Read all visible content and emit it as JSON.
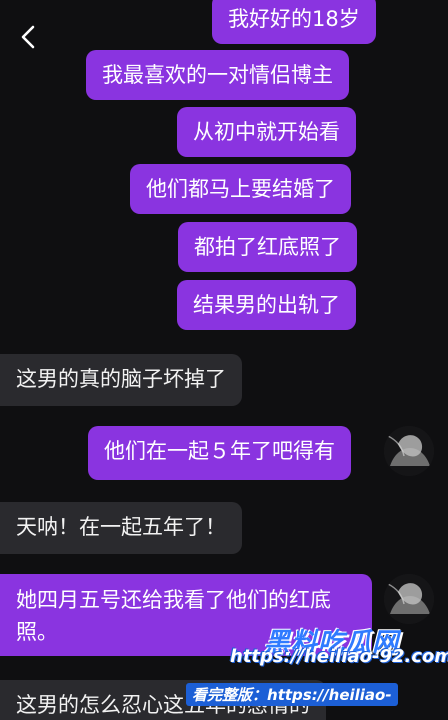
{
  "messages": [
    {
      "id": "m1",
      "side": "sent",
      "text": "我好好的18岁"
    },
    {
      "id": "m2",
      "side": "sent",
      "text": "我最喜欢的一对情侣博主"
    },
    {
      "id": "m3",
      "side": "sent",
      "text": "从初中就开始看"
    },
    {
      "id": "m4",
      "side": "sent",
      "text": "他们都马上要结婚了"
    },
    {
      "id": "m5",
      "side": "sent",
      "text": "都拍了红底照了"
    },
    {
      "id": "m6",
      "side": "sent",
      "text": "结果男的出轨了"
    },
    {
      "id": "m7",
      "side": "recv",
      "text": "这男的真的脑子坏掉了"
    },
    {
      "id": "m8",
      "side": "recv",
      "text": "他们在一起５年了吧得有"
    },
    {
      "id": "m9",
      "side": "recv",
      "text": "天呐！在一起五年了！"
    },
    {
      "id": "m10",
      "side": "recv",
      "text": "她四月五号还给我看了他们的红底照。"
    },
    {
      "id": "m11",
      "side": "recv",
      "text": "这男的怎么忍心这五年的感情的"
    }
  ],
  "watermark": {
    "logo": "黑料吃瓜网",
    "url": "https://heiliao-92.com",
    "tag_label": "看完整版：",
    "tag_url": "https://heiliao-"
  },
  "colors": {
    "background": "#0f0f11",
    "sent_bubble": "#8a34e0",
    "received_bubble": "#2a2a2e",
    "watermark_blue": "#1c5fd6"
  },
  "icons": {
    "back": "chevron-left-icon",
    "avatar": "contact-avatar"
  }
}
